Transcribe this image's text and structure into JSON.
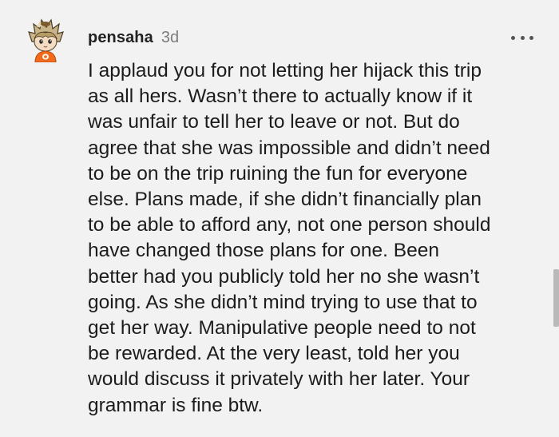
{
  "comment": {
    "username": "pensaha",
    "timestamp": "3d",
    "avatar_icon": "avatar-icon",
    "more_icon": "more-options-icon",
    "body_lines": [
      "I applaud you for not letting her hijack this trip",
      "as all hers. Wasn’t there to actually know if it",
      "was unfair to tell her to leave or not. But do",
      "agree that she was impossible and didn’t need",
      "to be on the trip ruining the fun for everyone",
      "else. Plans made, if she didn’t financially plan",
      "to be able to afford any, not one person should",
      "have changed those plans for one. Been",
      "better had you publicly told her no she wasn’t",
      "going. As she didn’t mind trying to use that to",
      "get her way. Manipulative people need to not",
      "be rewarded. At the very least, told her you",
      "would discuss it privately with her later. Your",
      "grammar is fine btw."
    ]
  },
  "colors": {
    "background": "#f2f2f2",
    "username": "#222222",
    "timestamp": "#7c7c7c",
    "text": "#1c1c1c",
    "avatar_shirt": "#f26b1d"
  }
}
